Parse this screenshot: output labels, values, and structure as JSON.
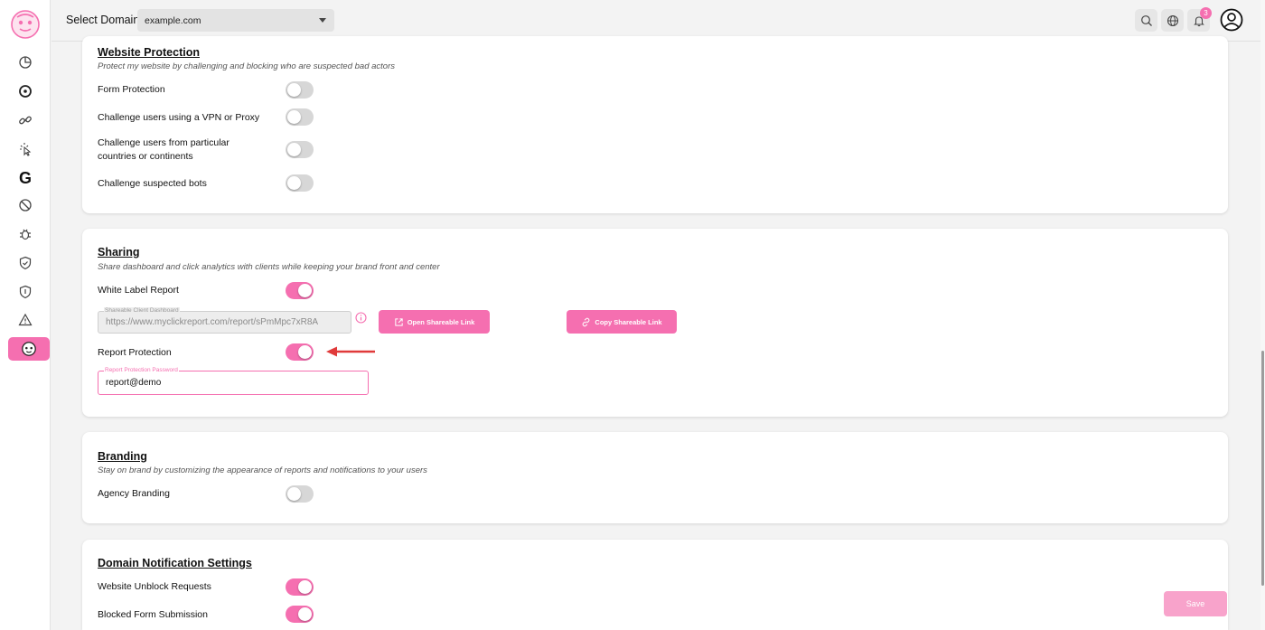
{
  "topbar": {
    "domain_label": "Select Domain",
    "domain_value": "example.com",
    "notification_count": "3"
  },
  "website_protection": {
    "title": "Website Protection",
    "subtitle": "Protect my website by challenging and blocking who are suspected bad actors",
    "rows": [
      {
        "label": "Form Protection",
        "on": false
      },
      {
        "label": "Challenge users using a VPN or Proxy",
        "on": false
      },
      {
        "label": "Challenge users from particular countries or continents",
        "on": false
      },
      {
        "label": "Challenge suspected bots",
        "on": false
      }
    ]
  },
  "sharing": {
    "title": "Sharing",
    "subtitle": "Share dashboard and click analytics with clients while keeping your brand front and center",
    "white_label_label": "White Label Report",
    "white_label_on": true,
    "dashboard_legend": "Shareable Client Dashboard",
    "dashboard_url": "https://www.myclickreport.com/report/sPmMpc7xR8A",
    "open_link_label": "Open Shareable Link",
    "copy_link_label": "Copy Shareable Link",
    "report_protection_label": "Report Protection",
    "report_protection_on": true,
    "password_legend": "Report Protection Password",
    "password_value": "report@demo"
  },
  "branding": {
    "title": "Branding",
    "subtitle": "Stay on brand by customizing the appearance of reports and notifications to your users",
    "agency_label": "Agency Branding",
    "agency_on": false
  },
  "notifications": {
    "title": "Domain Notification Settings",
    "unblock_label": "Website Unblock Requests",
    "unblock_on": true,
    "blocked_form_label": "Blocked Form Submission",
    "blocked_form_on": true
  },
  "save_label": "Save",
  "colors": {
    "accent": "#f56fb0",
    "annotation_arrow": "#e03a3a"
  }
}
